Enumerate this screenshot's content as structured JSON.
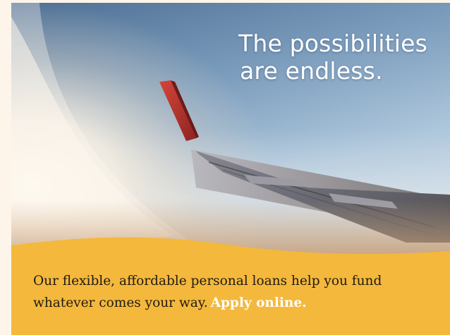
{
  "headline": {
    "line1": "The possibilities",
    "line2": "are endless."
  },
  "body": {
    "line1": "Our flexible, affordable personal loans help you fund",
    "line2": "whatever comes your way."
  },
  "cta": {
    "label": "Apply online."
  },
  "colors": {
    "page_background": "#fdf5ea",
    "banner_yellow": "#f4b83c",
    "headline_text": "#ffffff",
    "body_text": "#1f1b16",
    "cta_text": "#ffffff",
    "wingtip_red": "#c0392b"
  }
}
